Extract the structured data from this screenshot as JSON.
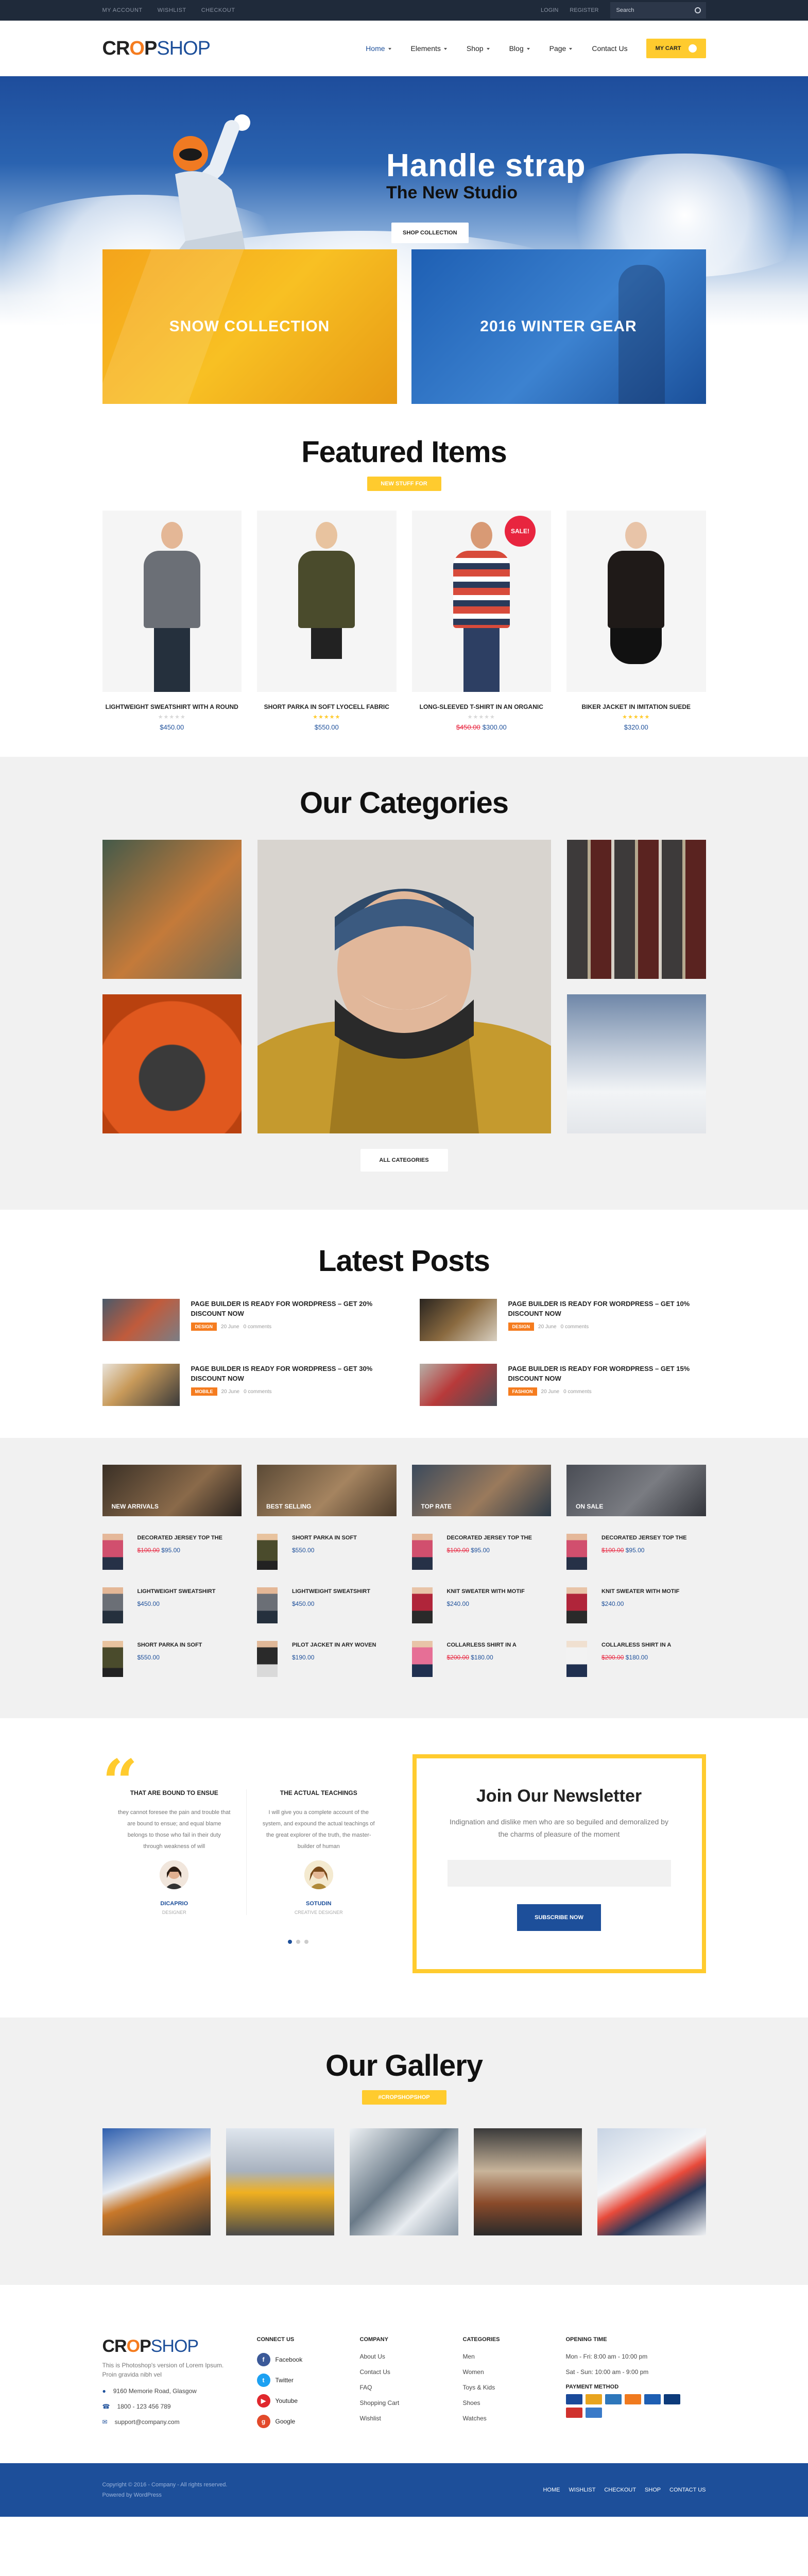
{
  "topbar": {
    "left": [
      "My account",
      "Wishlist",
      "Checkout"
    ],
    "right": [
      "Login",
      "Register"
    ],
    "search_placeholder": "Search"
  },
  "logo": {
    "part1": "CR",
    "o": "O",
    "part2": "P",
    "shop": "SHOP"
  },
  "nav": [
    "Home",
    "Elements",
    "Shop",
    "Blog",
    "Page",
    "Contact Us"
  ],
  "cart": {
    "label": "MY CART",
    "count": "0"
  },
  "hero": {
    "title": "Handle strap",
    "subtitle": "The New Studio",
    "button": "SHOP COLLECTION"
  },
  "banners": [
    "SNOW COLLECTION",
    "2016 WINTER GEAR"
  ],
  "featured": {
    "title": "Featured Items",
    "pill": "NEW STUFF FOR",
    "products": [
      {
        "name": "LIGHTWEIGHT SWEATSHIRT WITH A ROUND",
        "price": "$450.00",
        "old": "",
        "stars": "★★★★★",
        "rated": false
      },
      {
        "name": "SHORT PARKA IN SOFT LYOCELL FABRIC",
        "price": "$550.00",
        "old": "",
        "stars": "★★★★★",
        "rated": true
      },
      {
        "name": "LONG-SLEEVED T-SHIRT IN AN ORGANIC",
        "price": "$300.00",
        "old": "$450.00",
        "stars": "★★★★★",
        "rated": false,
        "sale": "SALE!"
      },
      {
        "name": "BIKER JACKET IN IMITATION SUEDE",
        "price": "$320.00",
        "old": "",
        "stars": "★★★★★",
        "rated": true
      }
    ]
  },
  "categories": {
    "title": "Our Categories",
    "button": "ALL CATEGORIES"
  },
  "posts": {
    "title": "Latest Posts",
    "items": [
      {
        "title": "PAGE BUILDER IS READY FOR WORDPRESS – GET 20% DISCOUNT NOW",
        "tag": "DESIGN",
        "date": "20 June",
        "comments": "0 comments"
      },
      {
        "title": "PAGE BUILDER IS READY FOR WORDPRESS – GET 10% DISCOUNT NOW",
        "tag": "DESIGN",
        "date": "20 June",
        "comments": "0 comments"
      },
      {
        "title": "PAGE BUILDER IS READY FOR WORDPRESS – GET 30% DISCOUNT NOW",
        "tag": "MOBILE",
        "date": "20 June",
        "comments": "0 comments"
      },
      {
        "title": "PAGE BUILDER IS READY FOR WORDPRESS – GET 15% DISCOUNT NOW",
        "tag": "FASHION",
        "date": "20 June",
        "comments": "0 comments"
      }
    ]
  },
  "lists": [
    {
      "head": "NEW ARRIVALS",
      "items": [
        {
          "n": "DECORATED JERSEY TOP THE",
          "old": "$100.00",
          "p": "$95.00"
        },
        {
          "n": "LIGHTWEIGHT SWEATSHIRT",
          "old": "",
          "p": "$450.00"
        },
        {
          "n": "SHORT PARKA IN SOFT",
          "old": "",
          "p": "$550.00"
        }
      ]
    },
    {
      "head": "BEST SELLING",
      "items": [
        {
          "n": "SHORT PARKA IN SOFT",
          "old": "",
          "p": "$550.00"
        },
        {
          "n": "LIGHTWEIGHT SWEATSHIRT",
          "old": "",
          "p": "$450.00"
        },
        {
          "n": "PILOT JACKET IN ARY WOVEN",
          "old": "",
          "p": "$190.00"
        }
      ]
    },
    {
      "head": "TOP RATE",
      "items": [
        {
          "n": "DECORATED JERSEY TOP THE",
          "old": "$100.00",
          "p": "$95.00"
        },
        {
          "n": "KNIT SWEATER WITH MOTIF",
          "old": "",
          "p": "$240.00"
        },
        {
          "n": "COLLARLESS SHIRT IN A",
          "old": "$200.00",
          "p": "$180.00"
        }
      ]
    },
    {
      "head": "ON SALE",
      "items": [
        {
          "n": "DECORATED JERSEY TOP THE",
          "old": "$100.00",
          "p": "$95.00"
        },
        {
          "n": "KNIT SWEATER WITH MOTIF",
          "old": "",
          "p": "$240.00"
        },
        {
          "n": "COLLARLESS SHIRT IN A",
          "old": "$200.00",
          "p": "$180.00"
        }
      ]
    }
  ],
  "testimonials": [
    {
      "title": "THAT ARE BOUND TO ENSUE",
      "text": "they cannot foresee the pain and trouble that are bound to ensue; and equal blame belongs to those who fail in their duty through weakness of will",
      "name": "DICAPRIO",
      "role": "DESIGNER"
    },
    {
      "title": "THE ACTUAL TEACHINGS",
      "text": "I will give you a complete account of the system, and expound the actual teachings of the great explorer of the truth, the master-builder of human",
      "name": "SOTUDIN",
      "role": "CREATIVE DESIGNER"
    }
  ],
  "newsletter": {
    "title": "Join Our Newsletter",
    "text": "Indignation and dislike men who are so beguiled and demoralized by the charms of pleasure of the moment",
    "button": "SUBSCRIBE NOW"
  },
  "gallery": {
    "title": "Our Gallery",
    "pill": "#CROPSHOPSHOP"
  },
  "footer": {
    "about": "This is Photoshop's version of Lorem Ipsum. Proin gravida nibh vel",
    "address": "9160 Memorie Road, Glasgow",
    "phone": "1800 - 123 456 789",
    "email": "support@company.com",
    "connect": {
      "title": "CONNECT US",
      "items": [
        "Facebook",
        "Twitter",
        "Youtube",
        "Google"
      ]
    },
    "company": {
      "title": "COMPANY",
      "items": [
        "About Us",
        "Contact Us",
        "FAQ",
        "Shopping Cart",
        "Wishlist"
      ]
    },
    "cats": {
      "title": "CATEGORIES",
      "items": [
        "Men",
        "Women",
        "Toys & Kids",
        "Shoes",
        "Watches"
      ]
    },
    "hours": {
      "title": "OPENING TIME",
      "items": [
        "Mon - Fri: 8:00 am - 10:00 pm",
        "Sat - Sun: 10:00 am - 9:00 pm"
      ],
      "pay": "PAYMENT METHOD"
    },
    "copyright": "Copyright © 2016 - Company - All rights reserved.",
    "powered": "Powered by WordPress",
    "links": [
      "HOME",
      "WISHLIST",
      "CHECKOUT",
      "SHOP",
      "CONTACT US"
    ]
  }
}
